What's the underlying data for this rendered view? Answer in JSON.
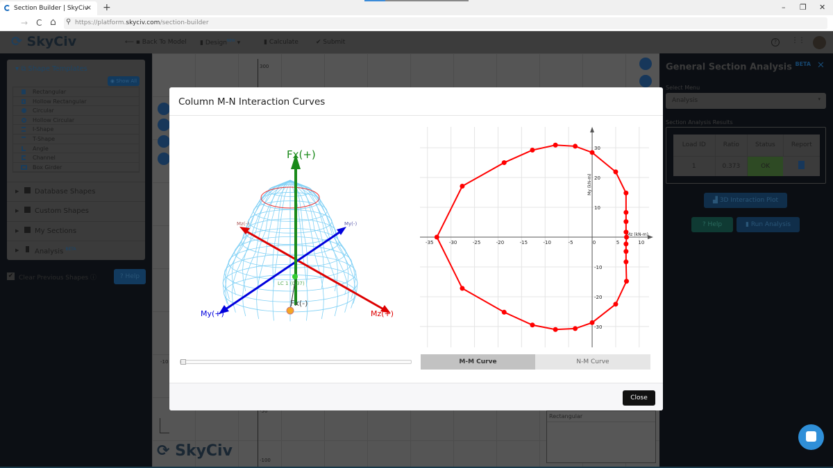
{
  "browser": {
    "tab_title": "Section Builder | SkyCiv",
    "url_prefix": "https://platform.",
    "url_domain": "skyciv.com",
    "url_path": "/section-builder",
    "new_tab": "+",
    "tab_close": "×",
    "min": "–",
    "max": "❐",
    "close": "✕",
    "menu": "≡",
    "back": "←",
    "forward": "→",
    "reload": "C",
    "home": "⌂",
    "search": "⚲"
  },
  "app": {
    "brand": "SkyCiv",
    "nav": {
      "back": "Back To Model",
      "design": "Design",
      "design_badge": "NEW",
      "calculate": "Calculate",
      "submit": "Submit"
    },
    "help_icon": "?",
    "apps_icon": "⋮⋮"
  },
  "sidebar": {
    "shape_templates": "Shape Templates",
    "show_all": "Show All",
    "shapes": [
      "Rectangular",
      "Hollow Rectangular",
      "Circular",
      "Hollow Circular",
      "I-Shape",
      "T-Shape",
      "Angle",
      "Channel",
      "Box Girder"
    ],
    "sections": [
      {
        "label": "Database Shapes"
      },
      {
        "label": "Custom Shapes"
      },
      {
        "label": "My Sections"
      },
      {
        "label": "Analysis",
        "badge": "BETA"
      }
    ],
    "clear_previous": "Clear Previous Shapes",
    "help": "Help"
  },
  "canvas": {
    "ticks": [
      "300",
      "-10",
      "-50",
      "-100"
    ],
    "shapes_list_item": "Rectangular",
    "logo": "SkyCiv"
  },
  "right_panel": {
    "title": "General Section Analysis",
    "badge": "BETA",
    "close": "✕",
    "select_label": "Select Menu",
    "select_value": "Analysis",
    "results_label": "Section Analysis Results",
    "table": {
      "headers": [
        "Load ID",
        "Ratio",
        "Status",
        "Report"
      ],
      "rows": [
        {
          "load_id": "1",
          "ratio": "0.373",
          "status": "OK"
        }
      ]
    },
    "plot_button": "3D Interaction Plot",
    "help_button": "Help",
    "run_button": "Run Analysis"
  },
  "modal": {
    "title": "Column M-N Interaction Curves",
    "plot3d": {
      "fx_pos": "Fx(+)",
      "fx_neg": "Fx(-)",
      "my_pos": "My(+)",
      "my_neg": "My(-)",
      "mz_pos": "Mz(+)",
      "mz_neg": "Mz(-)",
      "load_case": "LC 1 (0.37)",
      "slider_value": 0
    },
    "tabs": [
      {
        "label": "M-M Curve",
        "active": true
      },
      {
        "label": "N-M Curve",
        "active": false
      }
    ],
    "close": "Close"
  },
  "colors": {
    "curve": "#ff0000",
    "fx_axis": "#1a8a1a",
    "my_axis": "#0000dd",
    "mz_axis": "#dd0000",
    "surface": "#7fd0f5"
  },
  "chart_data": {
    "type": "line",
    "xlabel": "Mz (kN-m)",
    "ylabel": "My (kN-m)",
    "xlim": [
      -36,
      11.5
    ],
    "ylim": [
      -37,
      37
    ],
    "grid": true,
    "xticks": [
      -35,
      -30,
      -25,
      -20,
      -15,
      -10,
      -5,
      0,
      5,
      10
    ],
    "yticks": [
      -30,
      -20,
      -10,
      10,
      20,
      30
    ],
    "points": [
      [
        -33,
        0
      ],
      [
        -27.6,
        17.1
      ],
      [
        -18.7,
        25
      ],
      [
        -12.7,
        29.2
      ],
      [
        -7.8,
        30.9
      ],
      [
        -3.6,
        30.5
      ],
      [
        0,
        28.4
      ],
      [
        5,
        21.9
      ],
      [
        7.2,
        14.8
      ],
      [
        7.2,
        8.3
      ],
      [
        7.2,
        5.2
      ],
      [
        7.2,
        1.7
      ],
      [
        7.3,
        0
      ],
      [
        7.2,
        -2.3
      ],
      [
        7.2,
        -4.8
      ],
      [
        7.2,
        -8.3
      ],
      [
        7.3,
        -14.8
      ],
      [
        5,
        -22.5
      ],
      [
        0,
        -28.7
      ],
      [
        -3.6,
        -30.7
      ],
      [
        -7.8,
        -31
      ],
      [
        -12.7,
        -29.5
      ],
      [
        -18.7,
        -25.2
      ],
      [
        -27.6,
        -17.2
      ],
      [
        -33,
        0
      ]
    ]
  }
}
